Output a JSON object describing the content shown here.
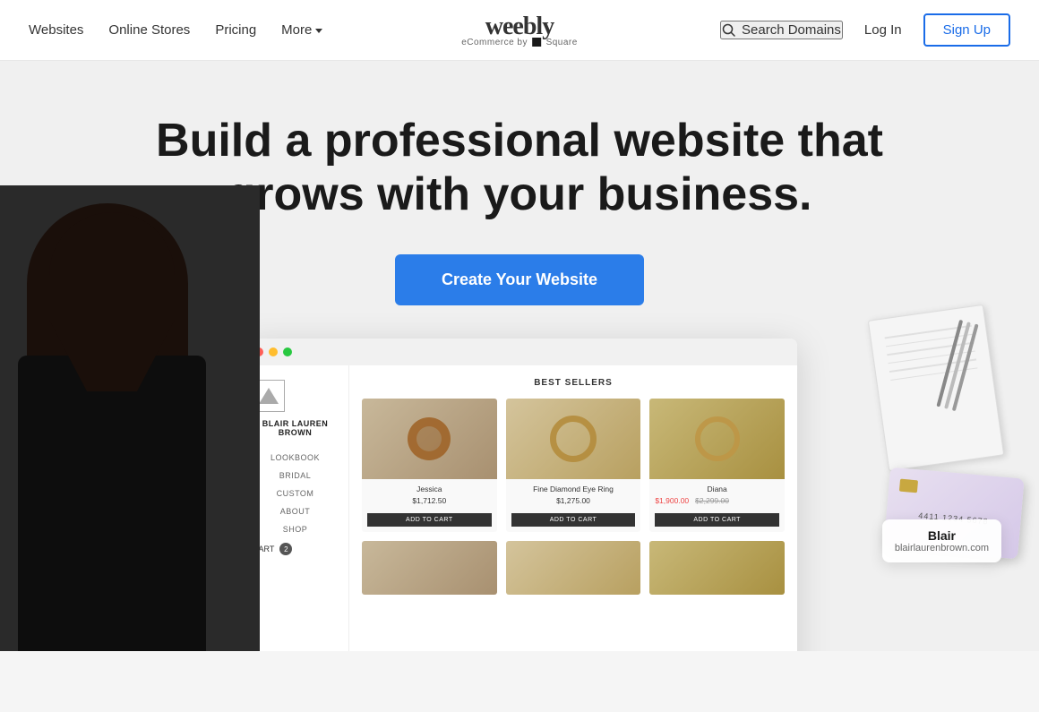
{
  "header": {
    "nav": {
      "websites": "Websites",
      "online_stores": "Online Stores",
      "pricing": "Pricing",
      "more": "More"
    },
    "logo": {
      "text": "weebly",
      "sub": "eCommerce by",
      "square_label": "Square"
    },
    "search_label": "Search Domains",
    "login_label": "Log In",
    "signup_label": "Sign Up"
  },
  "hero": {
    "title": "Build a professional website that grows with your business.",
    "cta_label": "Create Your Website"
  },
  "mockup": {
    "shop_name": "BLAIR LAUREN BROWN",
    "nav_items": [
      "LOOKBOOK",
      "BRIDAL",
      "CUSTOM",
      "ABOUT",
      "SHOP"
    ],
    "cart_label": "CART",
    "cart_count": "2",
    "best_sellers_label": "BEST SELLERS",
    "products": [
      {
        "name": "Jessica",
        "price": "$1,712.50",
        "strike_price": null,
        "orig_price": null,
        "btn": "ADD TO CART"
      },
      {
        "name": "Fine Diamond Eye Ring",
        "price": "$1,275.00",
        "strike_price": null,
        "orig_price": null,
        "btn": "ADD TO CART"
      },
      {
        "name": "Diana",
        "price": "$1,900.00",
        "strike_price": "$1,900.00",
        "orig_price": "$2,299.00",
        "btn": "ADD TO CART"
      }
    ]
  },
  "blair_badge": {
    "name": "Blair",
    "url": "blairlaurenbrown.com"
  },
  "colors": {
    "cta_bg": "#2b7de9",
    "signup_color": "#1a6ce8"
  }
}
